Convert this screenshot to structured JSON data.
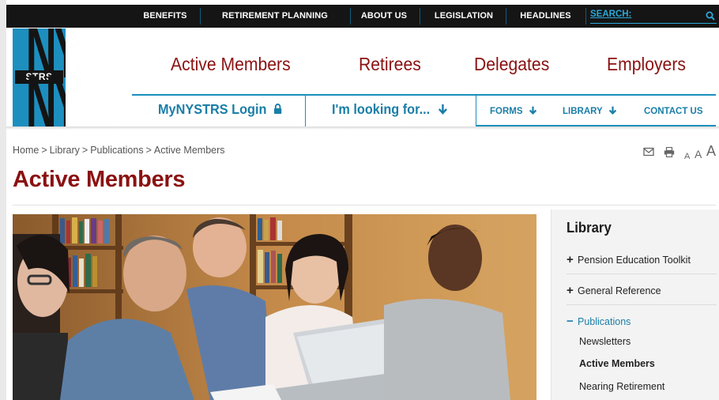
{
  "topbar": {
    "items": [
      "BENEFITS",
      "RETIREMENT PLANNING",
      "ABOUT US",
      "LEGISLATION",
      "HEADLINES"
    ],
    "search_label": "SEARCH:"
  },
  "logo": {
    "top": "NY",
    "middle": "STRS",
    "bottom": "NY"
  },
  "main_nav": [
    "Active Members",
    "Retirees",
    "Delegates",
    "Employers"
  ],
  "sub_nav": {
    "login": "MyNYSTRS Login",
    "looking_for": "I'm looking for...",
    "forms": "FORMS",
    "library": "LIBRARY",
    "contact": "CONTACT US"
  },
  "breadcrumb": [
    "Home",
    "Library",
    "Publications",
    "Active Members"
  ],
  "breadcrumb_sep": ">",
  "font_sizer": [
    "A",
    "A",
    "A"
  ],
  "page_title": "Active Members",
  "photo": {
    "alt": ""
  },
  "sidebar": {
    "title": "Library",
    "items": [
      "Pension Education Toolkit",
      "General Reference"
    ],
    "open_item": "Publications",
    "sub_items": [
      "Newsletters",
      "Active Members",
      "Nearing Retirement"
    ]
  },
  "colors": {
    "maroon": "#8b1111",
    "teal": "#1a7ea8",
    "topbar": "#151515",
    "logo_blue": "#1d8fbf"
  }
}
